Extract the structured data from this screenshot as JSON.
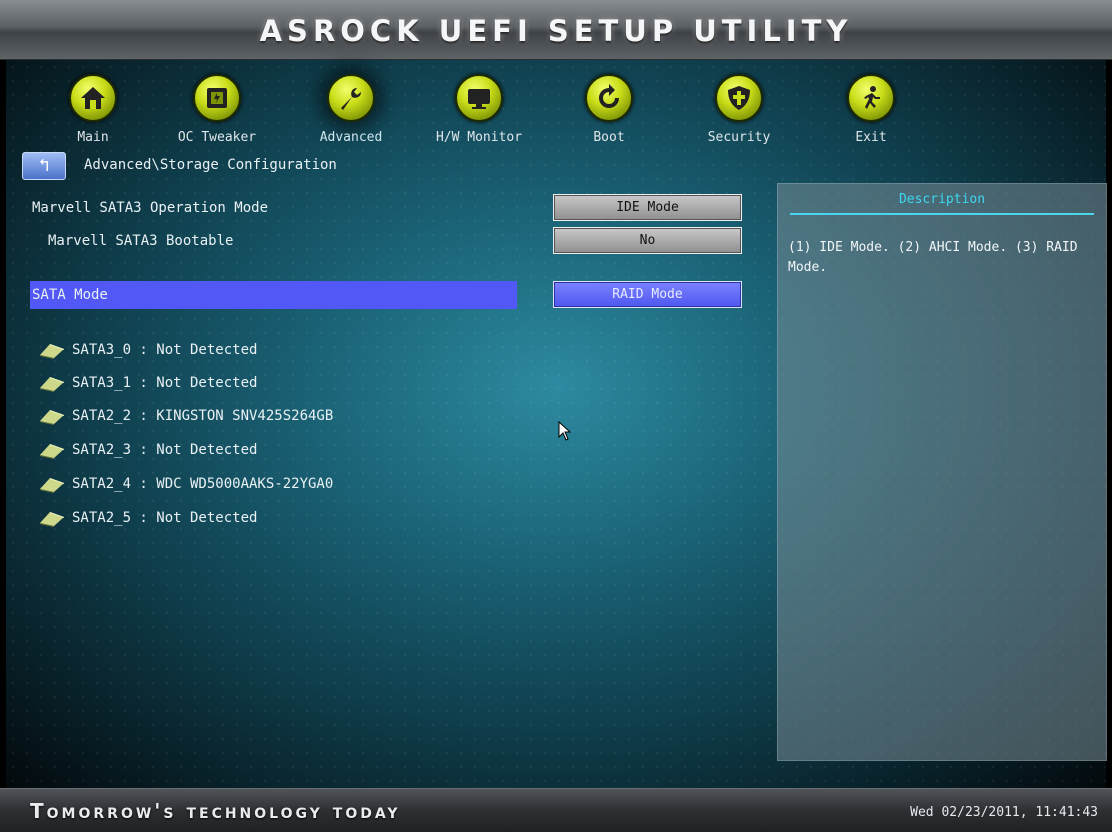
{
  "header": {
    "title": "ASROCK UEFI SETUP UTILITY"
  },
  "nav": {
    "items": [
      {
        "label": "Main",
        "icon": "home-icon"
      },
      {
        "label": "OC Tweaker",
        "icon": "chip-icon"
      },
      {
        "label": "Advanced",
        "icon": "wrench-icon"
      },
      {
        "label": "H/W Monitor",
        "icon": "monitor-icon"
      },
      {
        "label": "Boot",
        "icon": "refresh-icon"
      },
      {
        "label": "Security",
        "icon": "shield-icon"
      },
      {
        "label": "Exit",
        "icon": "running-man-icon"
      }
    ],
    "active": "Advanced"
  },
  "breadcrumb": {
    "path": "Advanced\\Storage Configuration"
  },
  "settings": {
    "marvell_mode": {
      "label": "Marvell SATA3 Operation Mode",
      "value": "IDE Mode"
    },
    "marvell_bootable": {
      "label": "Marvell SATA3 Bootable",
      "value": "No"
    },
    "sata_mode": {
      "label": "SATA Mode",
      "value": "RAID Mode"
    }
  },
  "drives": [
    "SATA3_0 : Not Detected",
    "SATA3_1 : Not Detected",
    "SATA2_2 : KINGSTON SNV425S264GB",
    "SATA2_3 : Not Detected",
    "SATA2_4 : WDC WD5000AAKS-22YGA0",
    "SATA2_5 : Not Detected"
  ],
  "description": {
    "title": "Description",
    "text": "(1) IDE Mode. (2) AHCI Mode. (3) RAID Mode."
  },
  "footer": {
    "slogan": "Tomorrow's technology today",
    "datetime": "Wed 02/23/2011, 11:41:43"
  },
  "colors": {
    "accent": "#5158f5",
    "nav_icon": "#c9dd18",
    "description_title": "#3fd6f0"
  }
}
